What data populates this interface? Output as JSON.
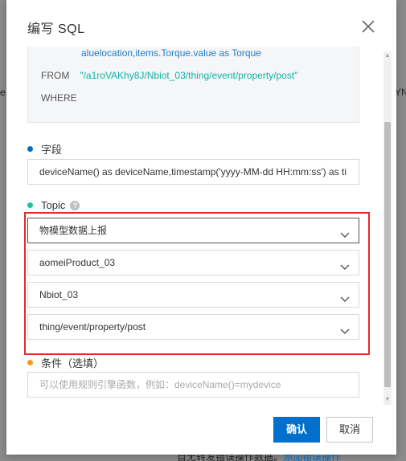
{
  "background": {
    "left_fragment": "e",
    "right_fragment": "YNb",
    "bottom_text": "自无转发错误操作数据。",
    "bottom_link": "添加错误操作"
  },
  "dialog": {
    "title": "编写 SQL",
    "sql": {
      "select_tail": "aluelocation,items.Torque.value as Torque",
      "from_keyword": "FROM",
      "from_topic": "\"/a1roVAKhy8J/Nbiot_03/thing/event/property/post\"",
      "where_keyword": "WHERE"
    },
    "fields_section": {
      "label": "字段",
      "value": "deviceName() as deviceName,timestamp('yyyy-MM-dd HH:mm:ss') as ti",
      "dot_color": "#0070cc"
    },
    "topic_section": {
      "label": "Topic",
      "help_icon": "?",
      "dot_color": "#1fc0a0",
      "selects": [
        {
          "value": "物模型数据上报"
        },
        {
          "value": "aomeiProduct_03"
        },
        {
          "value": "Nbiot_03"
        },
        {
          "value": "thing/event/property/post"
        }
      ]
    },
    "condition_section": {
      "label": "条件（选填）",
      "placeholder": "可以使用规则引擎函数，例如：deviceName()=mydevice",
      "dot_color": "#f39a1c"
    },
    "footer": {
      "confirm_label": "确认",
      "cancel_label": "取消"
    }
  },
  "colors": {
    "primary": "#0070cc",
    "highlight_outline": "#e22a2a",
    "sql_topic": "#11b2a6",
    "sql_select": "#1f7dc8"
  }
}
